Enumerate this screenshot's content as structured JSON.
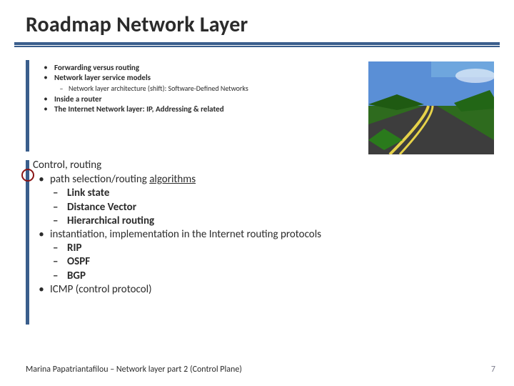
{
  "title": "Roadmap Network Layer",
  "upper": {
    "items": [
      {
        "text": "Forwarding versus routing",
        "bold": true
      },
      {
        "text": "Network layer service models",
        "bold": true
      }
    ],
    "sub": "Network layer architecture (shift): Software-Defined Networks",
    "items2": [
      {
        "text": "Inside a router",
        "bold": true
      },
      {
        "text": "The Internet Network layer: IP, Addressing & related",
        "bold": true
      }
    ]
  },
  "lower": {
    "head": "Control, routing",
    "item1_pre": "path selection/routing ",
    "item1_u": "algorithms",
    "subs1": [
      "Link state",
      "Distance Vector",
      "Hierarchical routing"
    ],
    "item2": "instantiation, implementation in the Internet routing protocols",
    "subs2": [
      "RIP",
      "OSPF",
      "BGP"
    ],
    "item3": "ICMP (control protocol)"
  },
  "footer": "Marina Papatriantafilou – Network layer part 2 (Control Plane)",
  "page": "7"
}
